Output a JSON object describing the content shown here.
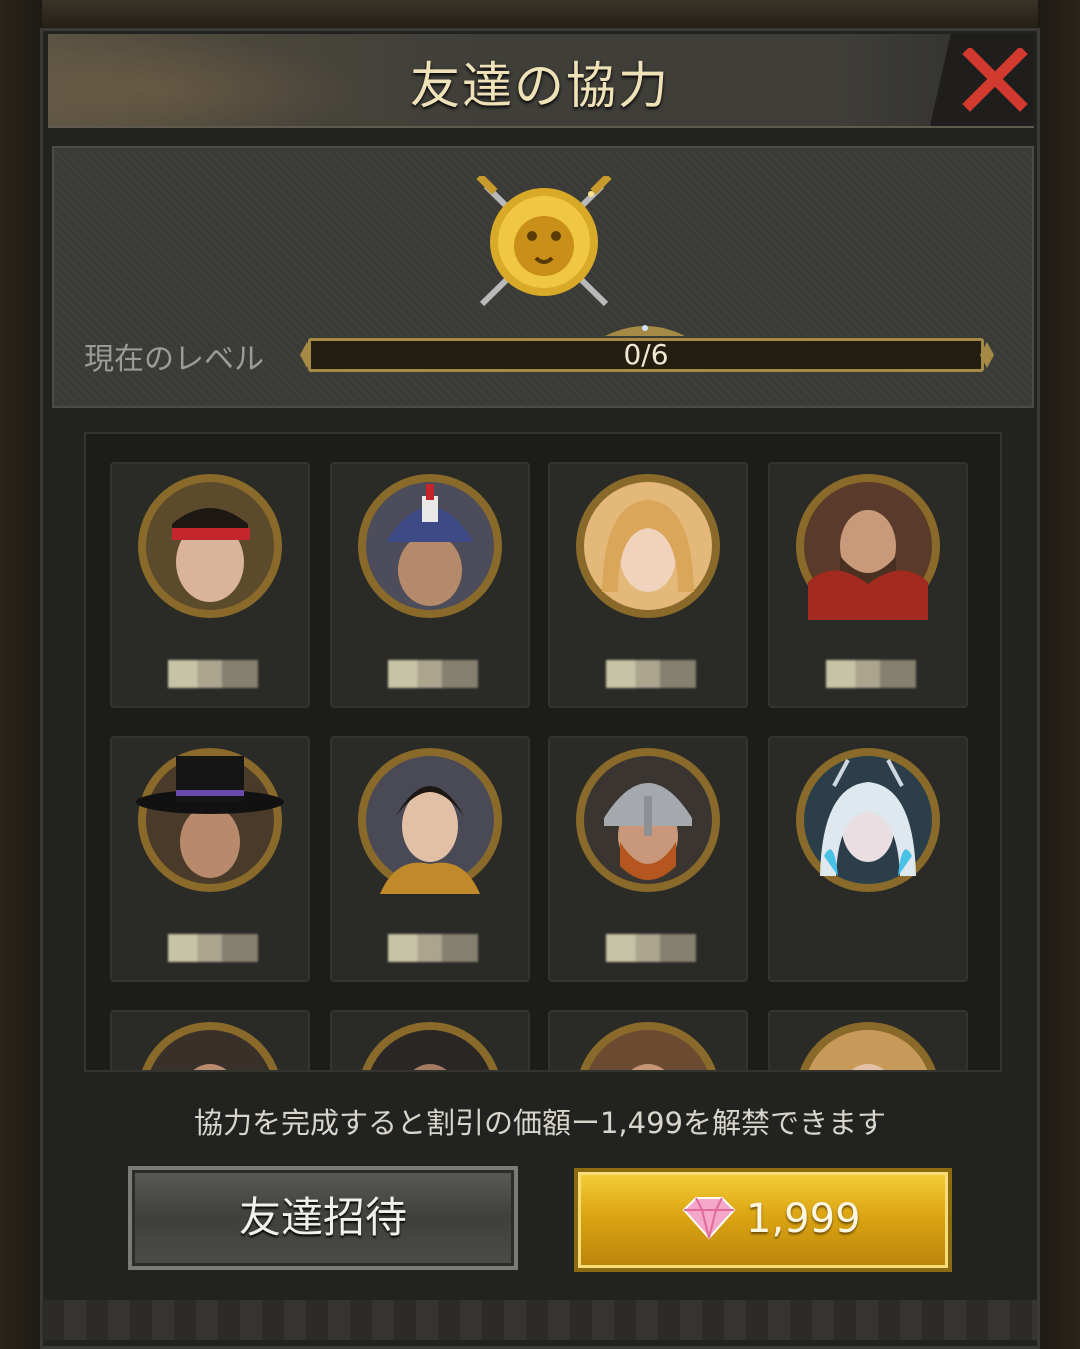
{
  "dialog": {
    "title": "友達の協力",
    "close_icon": "close-x-icon",
    "accent_close": "#d23a30"
  },
  "level": {
    "label": "現在のレベル",
    "progress_text": "0/6",
    "progress_fraction": 0,
    "emblem_icon": "gold-lion-crossed-swords-icon"
  },
  "friends": [
    {
      "portrait": "warrior-red-headband"
    },
    {
      "portrait": "napoleon-bicorne"
    },
    {
      "portrait": "blonde-woman"
    },
    {
      "portrait": "bearded-man-red-cloak"
    },
    {
      "portrait": "man-black-hat"
    },
    {
      "portrait": "young-noble"
    },
    {
      "portrait": "viking-helmet"
    },
    {
      "portrait": "ice-queen"
    },
    {
      "portrait": "partial-portrait"
    },
    {
      "portrait": "partial-portrait"
    },
    {
      "portrait": "partial-portrait"
    },
    {
      "portrait": "partial-portrait"
    }
  ],
  "footer": {
    "discount_text": "協力を完成すると割引の価額ー1,499を解禁できます",
    "invite_label": "友達招待",
    "buy_price": "1,999",
    "currency_icon": "pink-diamond-icon"
  }
}
